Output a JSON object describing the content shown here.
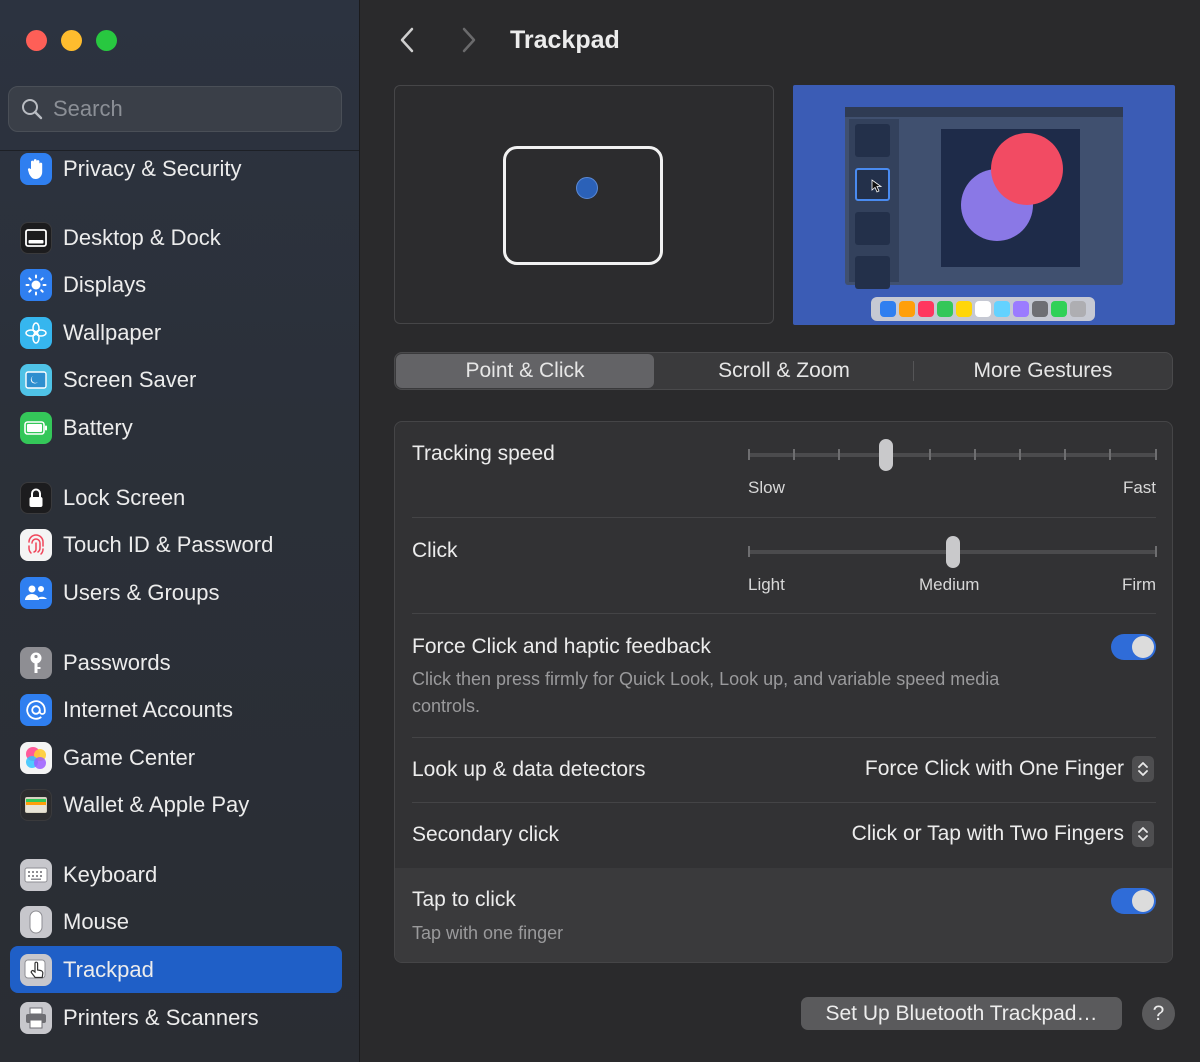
{
  "sidebar": {
    "search_placeholder": "Search",
    "items": [
      {
        "label": "Privacy & Security",
        "icon": "hand-icon",
        "color": "#2f7ff0"
      },
      {
        "label": "Desktop & Dock",
        "icon": "dock-icon",
        "color": "#1c1c1e"
      },
      {
        "label": "Displays",
        "icon": "sun-icon",
        "color": "#2f7ff0"
      },
      {
        "label": "Wallpaper",
        "icon": "flower-icon",
        "color": "#36b6ee"
      },
      {
        "label": "Screen Saver",
        "icon": "screen-saver-icon",
        "color": "#4fc2e6"
      },
      {
        "label": "Battery",
        "icon": "battery-icon",
        "color": "#34c759"
      },
      {
        "label": "Lock Screen",
        "icon": "lock-icon",
        "color": "#1c1c1e"
      },
      {
        "label": "Touch ID & Password",
        "icon": "fingerprint-icon",
        "color": "#f4f4f4"
      },
      {
        "label": "Users & Groups",
        "icon": "users-icon",
        "color": "#2f7ff0"
      },
      {
        "label": "Passwords",
        "icon": "key-icon",
        "color": "#8e8e93"
      },
      {
        "label": "Internet Accounts",
        "icon": "at-icon",
        "color": "#2f7ff0"
      },
      {
        "label": "Game Center",
        "icon": "game-center-icon",
        "color": "#f4f4f4"
      },
      {
        "label": "Wallet & Apple Pay",
        "icon": "wallet-icon",
        "color": "#2c2c2e"
      },
      {
        "label": "Keyboard",
        "icon": "keyboard-icon",
        "color": "#9a9a9e"
      },
      {
        "label": "Mouse",
        "icon": "mouse-icon",
        "color": "#9a9a9e"
      },
      {
        "label": "Trackpad",
        "icon": "trackpad-icon",
        "color": "#9a9a9e"
      },
      {
        "label": "Printers & Scanners",
        "icon": "printer-icon",
        "color": "#9a9a9e"
      }
    ],
    "selected": "Trackpad"
  },
  "header": {
    "title": "Trackpad"
  },
  "tabs": [
    "Point & Click",
    "Scroll & Zoom",
    "More Gestures"
  ],
  "active_tab": "Point & Click",
  "settings": {
    "tracking_speed": {
      "label": "Tracking speed",
      "min_label": "Slow",
      "max_label": "Fast",
      "value_fraction": 0.33
    },
    "click": {
      "label": "Click",
      "min_label": "Light",
      "mid_label": "Medium",
      "max_label": "Firm",
      "value": "Medium"
    },
    "force_click": {
      "label": "Force Click and haptic feedback",
      "description": "Click then press firmly for Quick Look, Look up, and variable speed media controls.",
      "enabled": true
    },
    "look_up": {
      "label": "Look up & data detectors",
      "value": "Force Click with One Finger"
    },
    "secondary_click": {
      "label": "Secondary click",
      "value": "Click or Tap with Two Fingers"
    },
    "tap_to_click": {
      "label": "Tap to click",
      "description": "Tap with one finger",
      "enabled": true
    }
  },
  "footer": {
    "bluetooth_button": "Set Up Bluetooth Trackpad…",
    "help_button": "?"
  },
  "colors": {
    "accent": "#2f6cd8",
    "selection": "#1f5fc7"
  }
}
